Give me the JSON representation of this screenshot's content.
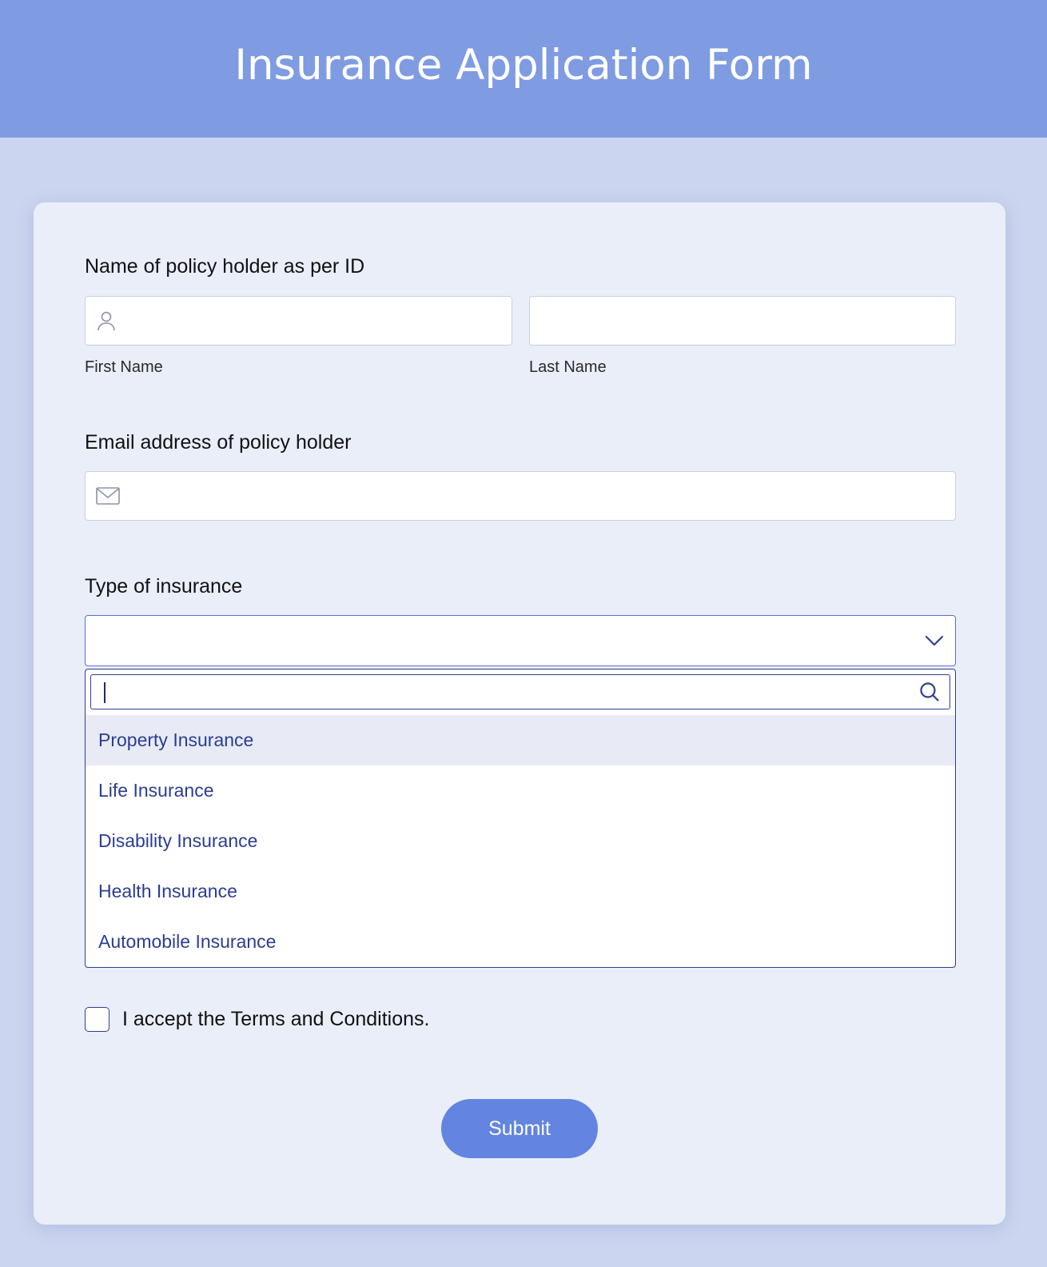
{
  "header": {
    "title": "Insurance Application Form"
  },
  "form": {
    "name_section": {
      "label": "Name of policy holder as per ID",
      "first_name": {
        "value": "",
        "placeholder": "",
        "sublabel": "First Name",
        "icon": "user-icon"
      },
      "last_name": {
        "value": "",
        "placeholder": "",
        "sublabel": "Last Name"
      }
    },
    "email_section": {
      "label": "Email address of policy holder",
      "email": {
        "value": "",
        "placeholder": "",
        "icon": "envelope-icon"
      }
    },
    "insurance_section": {
      "label": "Type of insurance",
      "selected_value": "",
      "dropdown_open": true,
      "search": {
        "value": "",
        "placeholder": "",
        "icon": "search-icon"
      },
      "options": [
        {
          "label": "Property Insurance",
          "highlighted": true
        },
        {
          "label": "Life Insurance",
          "highlighted": false
        },
        {
          "label": "Disability Insurance",
          "highlighted": false
        },
        {
          "label": "Health Insurance",
          "highlighted": false
        },
        {
          "label": "Automobile Insurance",
          "highlighted": false
        }
      ]
    },
    "terms": {
      "label": "I accept the Terms and Conditions.",
      "checked": false
    },
    "submit_label": "Submit"
  },
  "colors": {
    "header_bg": "#7f9be2",
    "page_bg": "#cbd5ef",
    "card_bg": "#eaeef9",
    "accent": "#6384e0",
    "option_text": "#2b3d94",
    "dropdown_border": "#2e3f8f"
  }
}
